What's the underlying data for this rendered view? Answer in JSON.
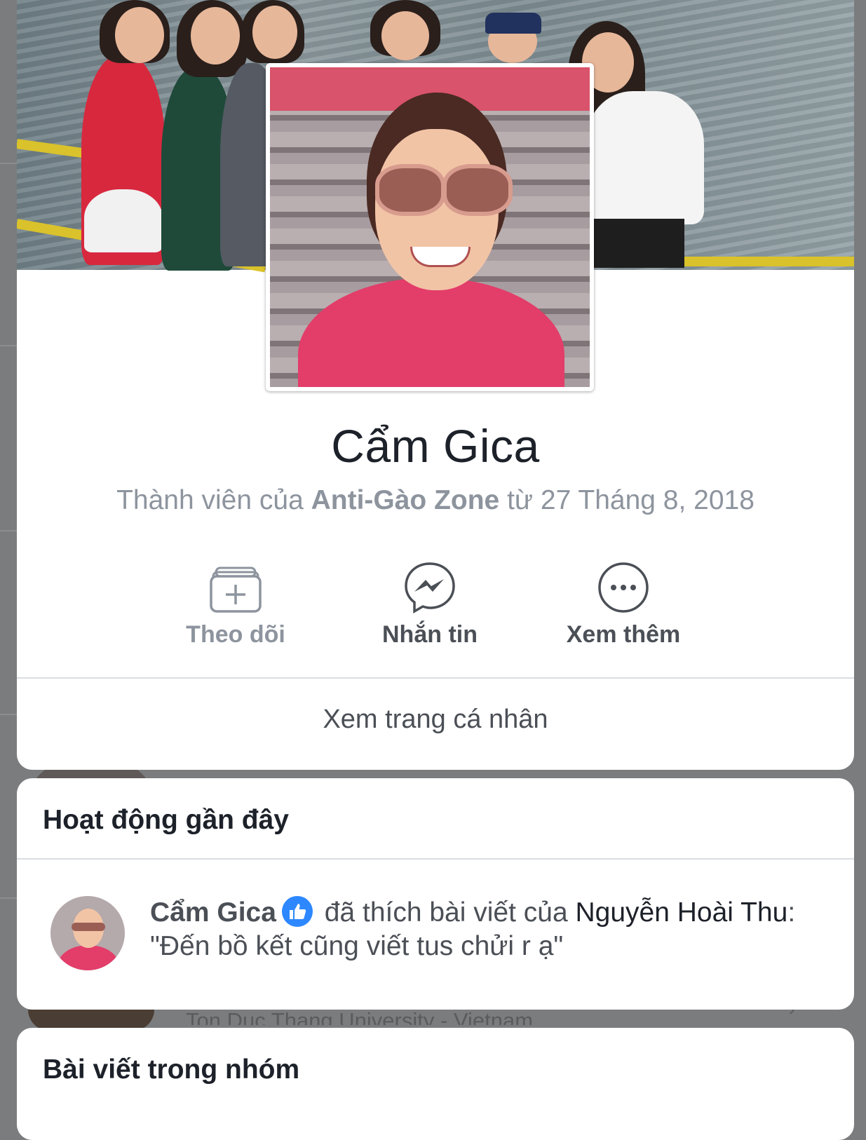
{
  "profile": {
    "name": "Cẩm Gica",
    "membership_prefix": "Thành viên của",
    "group_name": "Anti-Gào Zone",
    "membership_suffix": "từ 27 Tháng 8, 2018"
  },
  "actions": [
    {
      "label": "Theo dõi",
      "icon": "follow-add-icon",
      "enabled": false
    },
    {
      "label": "Nhắn tin",
      "icon": "messenger-icon",
      "enabled": true
    },
    {
      "label": "Xem thêm",
      "icon": "more-icon",
      "enabled": true
    }
  ],
  "view_profile_label": "Xem trang cá nhân",
  "recent_activity": {
    "title": "Hoạt động gần đây",
    "items": [
      {
        "actor": "Cẩm Gica",
        "icon": "like-icon",
        "verb": "đã thích bài viết của",
        "target": "Nguyễn Hoài Thu",
        "quote": ": \"Đến bồ kết cũng viết tus chửi r ạ\""
      }
    ]
  },
  "group_posts": {
    "title": "Bài viết trong nhóm"
  },
  "background": {
    "peek_text": "Ton Duc Thang University - Vietnam"
  },
  "colors": {
    "text_primary": "#1d2129",
    "text_secondary": "#8d949e",
    "like_blue": "#2d88ff",
    "overlay": "#7b7c7e"
  }
}
